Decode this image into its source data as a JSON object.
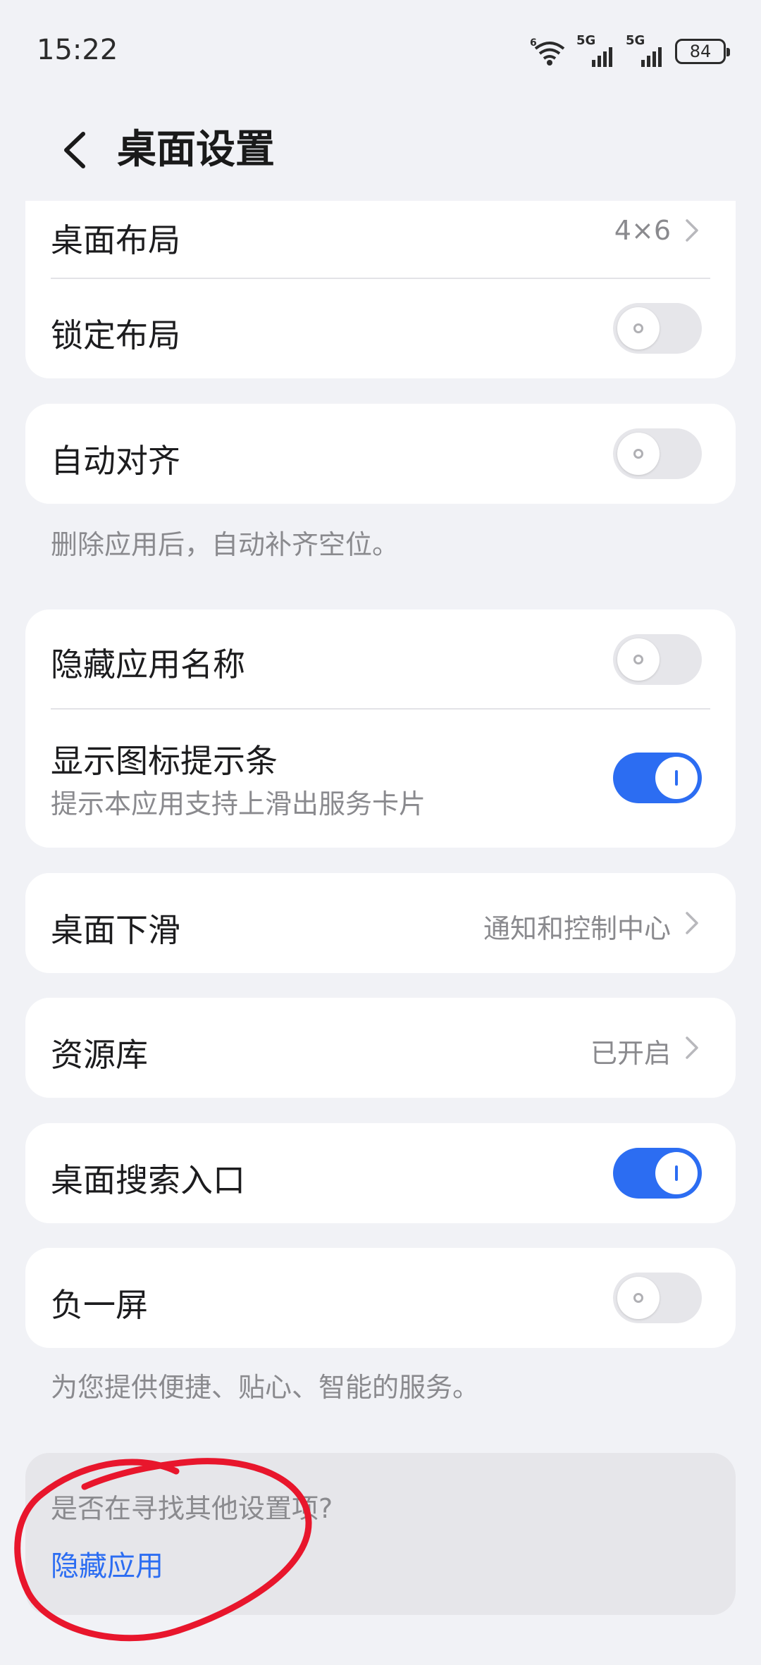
{
  "status_bar": {
    "time": "15:22",
    "wifi_badge": "6",
    "sim1": "5G",
    "sim2": "5G",
    "battery": "84"
  },
  "header": {
    "title": "桌面设置",
    "back_icon": "chevron-left-icon"
  },
  "layout_card": {
    "layout_label": "桌面布局",
    "layout_value": "4×6",
    "lock_label": "锁定布局",
    "lock_on": false
  },
  "align_card": {
    "label": "自动对齐",
    "on": false,
    "note": "删除应用后，自动补齐空位。"
  },
  "names_card": {
    "hide_names_label": "隐藏应用名称",
    "hide_names_on": false,
    "show_bar_label": "显示图标提示条",
    "show_bar_sub": "提示本应用支持上滑出服务卡片",
    "show_bar_on": true
  },
  "swipe_card": {
    "label": "桌面下滑",
    "value": "通知和控制中心"
  },
  "library_card": {
    "label": "资源库",
    "value": "已开启"
  },
  "search_card": {
    "label": "桌面搜索入口",
    "on": true
  },
  "minus_card": {
    "label": "负一屏",
    "on": false,
    "note": "为您提供便捷、贴心、智能的服务。"
  },
  "find_card": {
    "question": "是否在寻找其他设置项?",
    "link": "隐藏应用"
  },
  "colors": {
    "accent": "#2c6df2",
    "background": "#f1f2f6",
    "annotation_red": "#e8162c"
  }
}
